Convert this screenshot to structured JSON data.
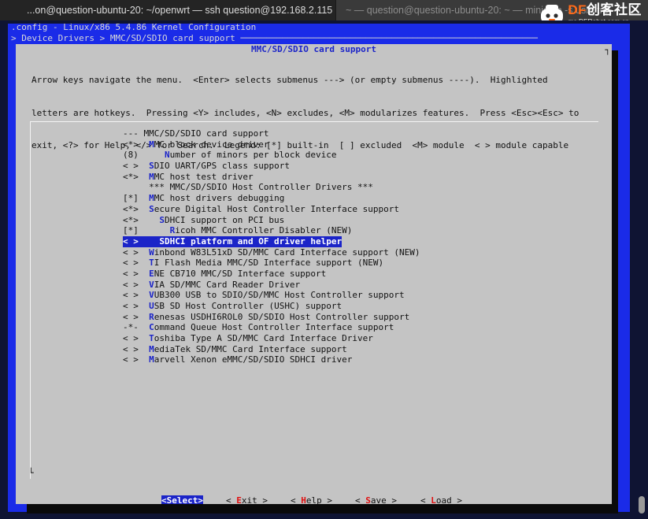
{
  "tabs": [
    {
      "label": "...on@question-ubuntu-20: ~/openwrt — ssh question@192.168.2.115"
    },
    {
      "label": "~ — question@question-ubuntu-20: ~ — minicom -s usb_tre"
    }
  ],
  "watermark": {
    "brand_df": "DF",
    "brand_cn": "创客社区",
    "url": "mc.DFRobot.com.cn"
  },
  "header": {
    "config_line": ".config - Linux/x86 5.4.86 Kernel Configuration",
    "breadcrumb_line": "> Device Drivers > MMC/SD/SDIO card support ─────────────────────────────────────────────────────────"
  },
  "dialog": {
    "title": "MMC/SD/SDIO card support",
    "instructions": [
      "Arrow keys navigate the menu.  <Enter> selects submenus ---> (or empty submenus ----).  Highlighted",
      "letters are hotkeys.  Pressing <Y> includes, <N> excludes, <M> modularizes features.  Press <Esc><Esc> to",
      "exit, <?> for Help, </> for Search.  Legend: [*] built-in  [ ] excluded  <M> module  < > module capable"
    ]
  },
  "menu": {
    "items": [
      {
        "prefix": "--- ",
        "hot": "",
        "rest": "MMC/SD/SDIO card support"
      },
      {
        "prefix": "<*>  ",
        "hot": "M",
        "rest": "MC block device driver"
      },
      {
        "prefix": "(8)     ",
        "hot": "N",
        "rest": "umber of minors per block device"
      },
      {
        "prefix": "< >  ",
        "hot": "S",
        "rest": "DIO UART/GPS class support"
      },
      {
        "prefix": "<*>  ",
        "hot": "M",
        "rest": "MC host test driver"
      },
      {
        "prefix": "     ",
        "hot": "",
        "rest": "*** MMC/SD/SDIO Host Controller Drivers ***"
      },
      {
        "prefix": "[*]  ",
        "hot": "M",
        "rest": "MC host drivers debugging"
      },
      {
        "prefix": "<*>  ",
        "hot": "S",
        "rest": "ecure Digital Host Controller Interface support"
      },
      {
        "prefix": "<*>    ",
        "hot": "S",
        "rest": "DHCI support on PCI bus"
      },
      {
        "prefix": "[*]      ",
        "hot": "R",
        "rest": "icoh MMC Controller Disabler (NEW)"
      },
      {
        "prefix": "< >    ",
        "hot": "S",
        "rest": "DHCI platform and OF driver helper",
        "selected": true
      },
      {
        "prefix": "< >  ",
        "hot": "W",
        "rest": "inbond W83L51xD SD/MMC Card Interface support (NEW)"
      },
      {
        "prefix": "< >  ",
        "hot": "T",
        "rest": "I Flash Media MMC/SD Interface support (NEW)"
      },
      {
        "prefix": "< >  ",
        "hot": "E",
        "rest": "NE CB710 MMC/SD Interface support"
      },
      {
        "prefix": "< >  ",
        "hot": "V",
        "rest": "IA SD/MMC Card Reader Driver"
      },
      {
        "prefix": "< >  ",
        "hot": "V",
        "rest": "UB300 USB to SDIO/SD/MMC Host Controller support"
      },
      {
        "prefix": "< >  ",
        "hot": "U",
        "rest": "SB SD Host Controller (USHC) support"
      },
      {
        "prefix": "< >  ",
        "hot": "R",
        "rest": "enesas USDHI6ROL0 SD/SDIO Host Controller support"
      },
      {
        "prefix": "-*-  ",
        "hot": "C",
        "rest": "ommand Queue Host Controller Interface support"
      },
      {
        "prefix": "< >  ",
        "hot": "T",
        "rest": "oshiba Type A SD/MMC Card Interface Driver"
      },
      {
        "prefix": "< >  ",
        "hot": "M",
        "rest": "ediaTek SD/MMC Card Interface support"
      },
      {
        "prefix": "< >  ",
        "hot": "M",
        "rest": "arvell Xenon eMMC/SD/SDIO SDHCI driver"
      }
    ]
  },
  "buttons": [
    {
      "pre": "<",
      "hot": "S",
      "post": "elect>",
      "active": true
    },
    {
      "pre": "< ",
      "hot": "E",
      "post": "xit >",
      "active": false
    },
    {
      "pre": "< ",
      "hot": "H",
      "post": "elp >",
      "active": false
    },
    {
      "pre": "< ",
      "hot": "S",
      "post": "ave >",
      "active": false
    },
    {
      "pre": "< ",
      "hot": "L",
      "post": "oad >",
      "active": false
    }
  ],
  "colors": {
    "terminal_blue": "#1a2be8",
    "dialog_gray": "#c4c4c4",
    "hotkey_blue": "#1b24c8",
    "button_hotkey_red": "#e01010"
  }
}
